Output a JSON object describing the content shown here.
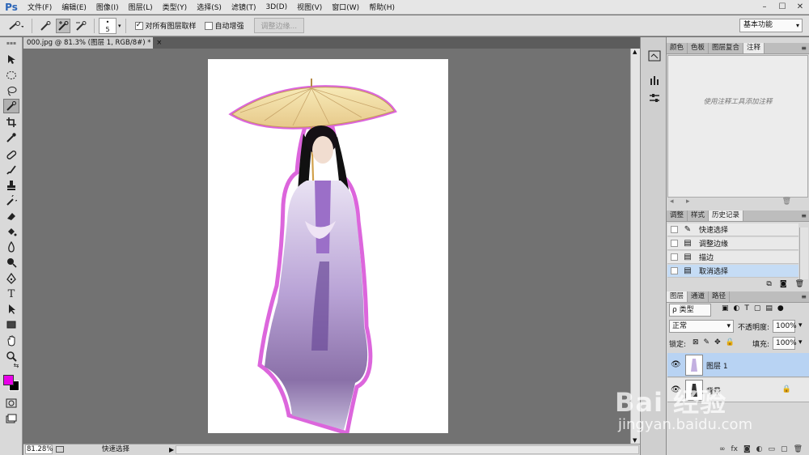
{
  "app": {
    "logo": "Ps"
  },
  "menu": [
    "文件(F)",
    "编辑(E)",
    "图像(I)",
    "图层(L)",
    "类型(Y)",
    "选择(S)",
    "滤镜(T)",
    "3D(D)",
    "视图(V)",
    "窗口(W)",
    "帮助(H)"
  ],
  "window_controls": [
    "–",
    "☐",
    "✕"
  ],
  "options": {
    "brush_size": "5",
    "sample_all_layers_label": "对所有图层取样",
    "sample_all_layers_checked": "✓",
    "auto_enhance_label": "自动增强",
    "refine_edge_label": "调整边缘...",
    "workspace": "基本功能"
  },
  "document": {
    "tab_title": "000.jpg @ 81.3% (图层 1, RGB/8#) *",
    "close": "×"
  },
  "status": {
    "zoom": "81.28%",
    "text": "快速选择",
    "arrow": "▶"
  },
  "colors": {
    "foreground": "#e800e8",
    "background": "#000000",
    "selection_glow": "#d64bd6",
    "history_selected": "#c5dcf5",
    "layer_selected": "#b8d3f3"
  },
  "panels": {
    "top_tabs": [
      "颜色",
      "色板",
      "图层复合",
      "注释"
    ],
    "notes_hint": "使用注释工具添加注释",
    "mid_tabs": [
      "调整",
      "样式",
      "历史记录"
    ],
    "history": [
      {
        "label": "快速选择",
        "icon": "quick-select"
      },
      {
        "label": "调整边缘",
        "icon": "doc"
      },
      {
        "label": "描边",
        "icon": "doc"
      },
      {
        "label": "取消选择",
        "icon": "doc"
      }
    ],
    "layer_tabs": [
      "图层",
      "通道",
      "路径"
    ],
    "layer_filter": "ρ 类型",
    "blend_mode": "正常",
    "opacity_label": "不透明度:",
    "opacity_value": "100%",
    "lock_label": "锁定:",
    "fill_label": "填充:",
    "fill_value": "100%",
    "layers": [
      {
        "name": "图层 1",
        "selected": true
      },
      {
        "name": "背景",
        "locked": true
      }
    ],
    "bottom_icons": [
      "∞",
      "fx",
      "◙",
      "◐",
      "▭",
      "▢",
      "🗑"
    ]
  },
  "watermark": {
    "brand": "Bai 经验",
    "url": "jingyan.baidu.com"
  }
}
